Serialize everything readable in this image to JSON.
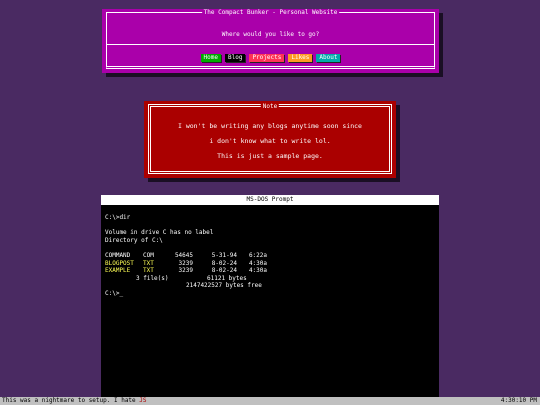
{
  "header": {
    "title": "The Compact Bunker - Personal Website",
    "question": "Where would you like to go?",
    "nav": [
      {
        "label": "Home",
        "bg": "#00aa00"
      },
      {
        "label": "Blog",
        "bg": "#000000"
      },
      {
        "label": "Projects",
        "bg": "#ff3355"
      },
      {
        "label": "Likes",
        "bg": "#ff9922"
      },
      {
        "label": "About",
        "bg": "#00aaaa"
      }
    ]
  },
  "note": {
    "title": "Note",
    "lines": [
      "I won't be writing any blogs anytime soon since",
      "i don't know what to write lol.",
      "This is just a sample page."
    ]
  },
  "dos": {
    "title": "MS-DOS Prompt",
    "prompt": "C:\\>dir",
    "volume": "Volume in drive C has no label",
    "directory": "Directory of C:\\",
    "files": [
      {
        "name": "COMMAND",
        "ext": "COM",
        "size": "54645",
        "date": "5-31-94",
        "time": "6:22a",
        "highlight": false
      },
      {
        "name": "BLOGPOST",
        "ext": "TXT",
        "size": "3239",
        "date": "8-02-24",
        "time": "4:30a",
        "highlight": true
      },
      {
        "name": "EXAMPLE",
        "ext": "TXT",
        "size": "3239",
        "date": "8-02-24",
        "time": "4:30a",
        "highlight": true
      }
    ],
    "summary_files": "3 file(s)",
    "summary_bytes": "61121 bytes",
    "free_bytes": "2147422527 bytes free",
    "cursor_prompt": "C:\\>_"
  },
  "status": {
    "message": "This was a nightmare to setup. I hate",
    "message_highlight": "JS",
    "clock": "4:30:10 PM"
  }
}
